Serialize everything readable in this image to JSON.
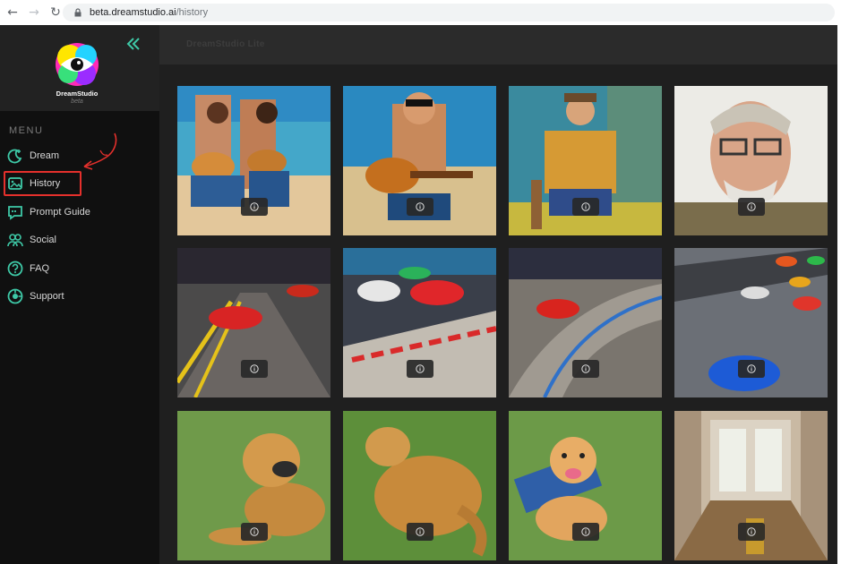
{
  "browser": {
    "url_host": "beta.dreamstudio.ai",
    "url_path": "/history"
  },
  "app": {
    "brand_name": "DreamStudio",
    "brand_sub": "beta",
    "title": "DreamStudio Lite"
  },
  "sidebar": {
    "menu_label": "MENU",
    "items": [
      {
        "label": "Dream",
        "icon": "dream-icon"
      },
      {
        "label": "History",
        "icon": "history-icon"
      },
      {
        "label": "Prompt Guide",
        "icon": "prompt-guide-icon"
      },
      {
        "label": "Social",
        "icon": "social-icon"
      },
      {
        "label": "FAQ",
        "icon": "faq-icon"
      },
      {
        "label": "Support",
        "icon": "support-icon"
      }
    ],
    "active_item": "History"
  },
  "colors": {
    "accent": "#3ec9a7",
    "highlight": "#e5302c",
    "sidebar_bg": "#101010",
    "content_bg": "#1f1f1f"
  },
  "gallery": {
    "rows": 3,
    "columns": 4,
    "tiles": [
      {
        "subject": "guitar-beach-duo"
      },
      {
        "subject": "guitar-beach-man"
      },
      {
        "subject": "seated-painter"
      },
      {
        "subject": "old-man-glasses"
      },
      {
        "subject": "red-car-city"
      },
      {
        "subject": "racing-cars-track"
      },
      {
        "subject": "red-car-curve"
      },
      {
        "subject": "blue-car-race"
      },
      {
        "subject": "golden-retriever-lying"
      },
      {
        "subject": "golden-retriever-back"
      },
      {
        "subject": "golden-retriever-puppy"
      },
      {
        "subject": "hallway-door"
      }
    ]
  }
}
